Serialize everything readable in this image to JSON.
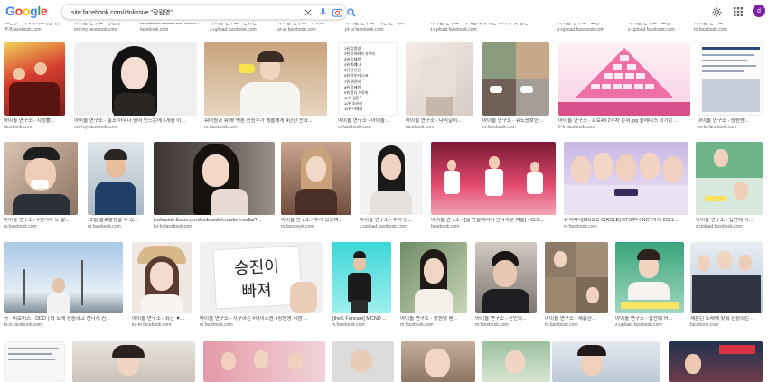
{
  "header": {
    "search_value": "site:facebook.com/idolissue \"장원영\"",
    "avatar_letter": "d",
    "colors": {
      "logo": [
        "#4285F4",
        "#EA4335",
        "#FBBC05",
        "#4285F4",
        "#34A853",
        "#EA4335"
      ],
      "avatar": "#7b1fa2"
    }
  },
  "row0": [
    {
      "title": "으_쌍 - 미래아이코 (넘다)",
      "source": "ff-ff.facebook.com"
    },
    {
      "title": "아이돌 연구소 - 장원영",
      "source": "ms-my.facebook.com"
    },
    {
      "title": "lookaside.fbsbx.com/lookaside",
      "source": "facebook.com"
    },
    {
      "title": "아이돌 연구소 - 안유진",
      "source": "z-upload.facebook.com"
    },
    {
      "title": "아이돌 연구소 - 아이브",
      "source": "ar-ar.facebook.com"
    },
    {
      "title": "아이돌 연구소 - 다른 분 대화",
      "source": "pt-br.facebook.com"
    },
    {
      "title": "아이돌 연구소 - 사례들에게 이런 이야기 첫 발언",
      "source": "z-upload.facebook.com"
    },
    {
      "title": "아이돌 연구소 - 최근",
      "source": "m.facebook.com"
    },
    {
      "title": "아이돌 연구소 - 표창",
      "source": "z-upload.facebook.com"
    },
    {
      "title": "아이돌 연구소 - 표창",
      "source": "z-upload.facebook.com"
    },
    {
      "title": "아이돌 연구소",
      "source": "m.facebook.com"
    }
  ],
  "row1": [
    {
      "title": "아이돌 연구소 - 시청률...",
      "source": "facebook.com"
    },
    {
      "title": "아이돌 연구소 - 실조 아무나 넘어 인드는에 6개월 이...",
      "source": "ms-my.facebook.com"
    },
    {
      "title": "워너원과 뭐해! 빅톤 한승우가 멤플에게 4년간 잔하...",
      "source": "m.facebook.com"
    },
    {
      "title": "아이돌 연구소 - 아이돌...",
      "source": "m.facebook.com",
      "list_lines": [
        "1위 장원영",
        "2위 미야와키 사쿠라",
        "3위 김채원",
        "4위 최예나",
        "5위 안유진",
        "6위 야부키 나코",
        "7위 권은비",
        "8위 강혜원",
        "9위 혼다 히토미",
        "10위 김민주",
        "11위 조유리",
        "12위 이채연"
      ]
    },
    {
      "title": "아이돌 연구소 - 다리길이...",
      "source": "facebook.com"
    },
    {
      "title": "아이돌 연구소 - 유노윤호한...",
      "source": "m.facebook.com"
    },
    {
      "title": "아이돌 연구소 - 프로48 2주차 순위.jpg 플레디스 이가은 ...",
      "source": "fr-fr.facebook.com"
    },
    {
      "title": "아이돌 연구소 - 장원영...",
      "source": "ko-kr.facebook.com"
    }
  ],
  "row2": [
    {
      "title": "아이돌 연구소 - #연기자 또 잘...",
      "source": "m.facebook.com"
    },
    {
      "title": "12월 솔로활동할 수 있...",
      "source": "m.facebook.com"
    },
    {
      "title": "lookaside.fbsbx.com/lookaside/crawler/media/?...",
      "source": "ko-kr.facebook.com"
    },
    {
      "title": "아이돌 연구소 - 투게 있으며...",
      "source": "m.facebook.com"
    },
    {
      "title": "아이돌 연구소 - 수지 장...",
      "source": "z-upload.facebook.com"
    },
    {
      "title": "아이돌 연구소 - [일 안잘려져서 안타까운 여돌] - CLC...",
      "source": "facebook.com"
    },
    {
      "title": "뮤직비디[MUSIC CIRCLE] BTS부터 NCT까지 2021...",
      "source": "m.facebook.com"
    },
    {
      "title": "아이돌 연구소 - 집안에 어...",
      "source": "z-upload.facebook.com"
    }
  ],
  "row3": [
    {
      "title": "극 · 미로미즈 · DDD | 와 노래 청중하고 신나게 진...",
      "source": "hi-in.facebook.com"
    },
    {
      "title": "아이돌 연구소 - 최근 ▼...",
      "source": "ko-kr.facebook.com"
    },
    {
      "title": "아이돌 연구소 - 시구하는 #아이즈원 #장원영 직캠 ...",
      "source": "m.facebook.com",
      "sign_text": [
        "승진이",
        "빠져"
      ]
    },
    {
      "title": "'[theK Fancam] MCND ...",
      "source": "m.facebook.com"
    },
    {
      "title": "아이돌 연구소 - 장원영 팬...",
      "source": "m.facebook.com"
    },
    {
      "title": "아이돌 연구소 - 진인의...",
      "source": "m.facebook.com"
    },
    {
      "title": "아이돌 연구소 - 새롭한...",
      "source": "m.facebook.com"
    },
    {
      "title": "아이돌 연구소 - 집안에 어...",
      "source": "z-upload.facebook.com"
    },
    {
      "title": "세븐틴 노래에 맞춰 한장하는 ...",
      "source": "facebook.com"
    }
  ]
}
